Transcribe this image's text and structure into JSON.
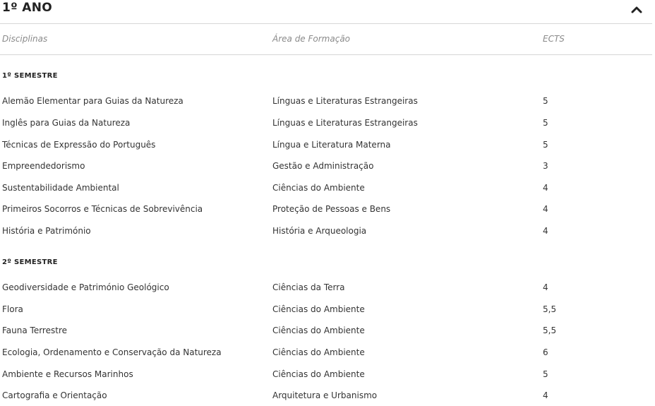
{
  "year": {
    "title": "1º ANO"
  },
  "columns": {
    "discipline": "Disciplinas",
    "area": "Área de Formação",
    "ects": "ECTS"
  },
  "semesters": [
    {
      "title": "1º SEMESTRE",
      "rows": [
        {
          "discipline": "Alemão Elementar para Guias da Natureza",
          "area": "Línguas e Literaturas Estrangeiras",
          "ects": "5"
        },
        {
          "discipline": "Inglês para Guias da Natureza",
          "area": "Línguas e Literaturas Estrangeiras",
          "ects": "5"
        },
        {
          "discipline": "Técnicas de Expressão do Português",
          "area": "Língua e Literatura Materna",
          "ects": "5"
        },
        {
          "discipline": "Empreendedorismo",
          "area": "Gestão e Administração",
          "ects": "3"
        },
        {
          "discipline": "Sustentabilidade Ambiental",
          "area": "Ciências do Ambiente",
          "ects": "4"
        },
        {
          "discipline": "Primeiros Socorros e Técnicas de Sobrevivência",
          "area": "Proteção de Pessoas e Bens",
          "ects": "4"
        },
        {
          "discipline": "História e Património",
          "area": "História e Arqueologia",
          "ects": "4"
        }
      ]
    },
    {
      "title": "2º SEMESTRE",
      "rows": [
        {
          "discipline": "Geodiversidade e Património Geológico",
          "area": "Ciências da Terra",
          "ects": "4"
        },
        {
          "discipline": "Flora",
          "area": "Ciências do Ambiente",
          "ects": "5,5"
        },
        {
          "discipline": "Fauna Terrestre",
          "area": "Ciências do Ambiente",
          "ects": "5,5"
        },
        {
          "discipline": "Ecologia, Ordenamento e Conservação da Natureza",
          "area": "Ciências do Ambiente",
          "ects": "6"
        },
        {
          "discipline": "Ambiente e Recursos Marinhos",
          "area": "Ciências do Ambiente",
          "ects": "5"
        },
        {
          "discipline": "Cartografia e Orientação",
          "area": "Arquitetura e Urbanismo",
          "ects": "4"
        }
      ]
    }
  ]
}
